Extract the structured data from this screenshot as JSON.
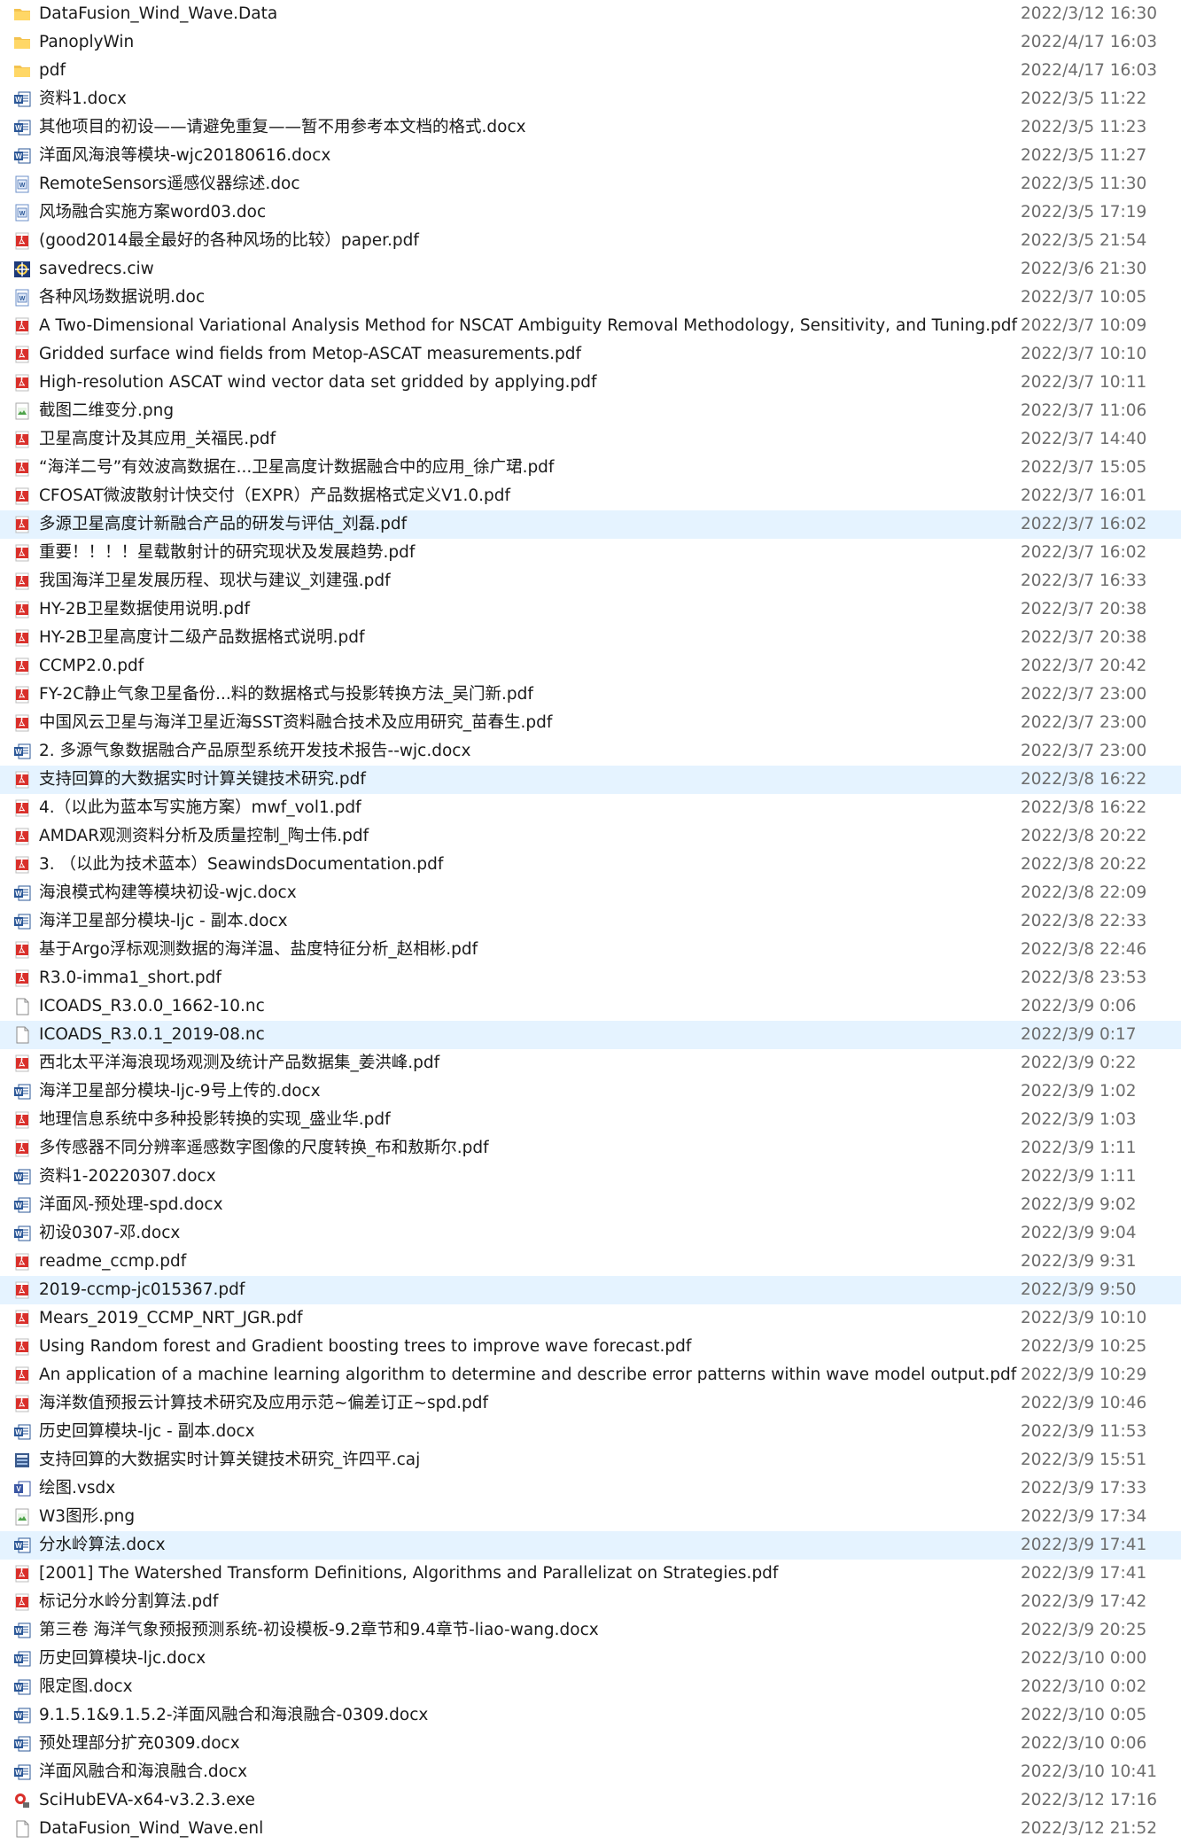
{
  "files": [
    {
      "name": "DataFusion_Wind_Wave.Data",
      "date": "2022/3/12 16:30",
      "icon": "folder-icon"
    },
    {
      "name": "PanoplyWin",
      "date": "2022/4/17 16:03",
      "icon": "folder-icon"
    },
    {
      "name": "pdf",
      "date": "2022/4/17 16:03",
      "icon": "folder-icon"
    },
    {
      "name": "资料1.docx",
      "date": "2022/3/5 11:22",
      "icon": "word-docx-icon"
    },
    {
      "name": "其他项目的初设——请避免重复——暂不用参考本文档的格式.docx",
      "date": "2022/3/5 11:23",
      "icon": "word-docx-icon"
    },
    {
      "name": "洋面风海浪等模块-wjc20180616.docx",
      "date": "2022/3/5 11:27",
      "icon": "word-docx-icon"
    },
    {
      "name": "RemoteSensors遥感仪器综述.doc",
      "date": "2022/3/5 11:30",
      "icon": "word-doc-icon"
    },
    {
      "name": "风场融合实施方案word03.doc",
      "date": "2022/3/5 17:19",
      "icon": "word-doc-icon"
    },
    {
      "name": "(good2014最全最好的各种风场的比较）paper.pdf",
      "date": "2022/3/5 21:54",
      "icon": "pdf-icon"
    },
    {
      "name": "savedrecs.ciw",
      "date": "2022/3/6 21:30",
      "icon": "ciw-icon"
    },
    {
      "name": "各种风场数据说明.doc",
      "date": "2022/3/7 10:05",
      "icon": "word-doc-icon"
    },
    {
      "name": "A Two-Dimensional Variational Analysis Method for NSCAT Ambiguity Removal Methodology, Sensitivity, and Tuning.pdf",
      "date": "2022/3/7 10:09",
      "icon": "pdf-icon"
    },
    {
      "name": "Gridded surface wind fields from Metop-ASCAT measurements.pdf",
      "date": "2022/3/7 10:10",
      "icon": "pdf-icon"
    },
    {
      "name": "High-resolution ASCAT wind vector data set gridded by applying.pdf",
      "date": "2022/3/7 10:11",
      "icon": "pdf-icon"
    },
    {
      "name": "截图二维变分.png",
      "date": "2022/3/7 11:06",
      "icon": "png-icon"
    },
    {
      "name": "卫星高度计及其应用_关福民.pdf",
      "date": "2022/3/7 14:40",
      "icon": "pdf-icon"
    },
    {
      "name": "“海洋二号”有效波高数据在...卫星高度计数据融合中的应用_徐广珺.pdf",
      "date": "2022/3/7 15:05",
      "icon": "pdf-icon"
    },
    {
      "name": "CFOSAT微波散射计快交付（EXPR）产品数据格式定义V1.0.pdf",
      "date": "2022/3/7 16:01",
      "icon": "pdf-icon"
    },
    {
      "name": "多源卫星高度计新融合产品的研发与评估_刘磊.pdf",
      "date": "2022/3/7 16:02",
      "icon": "pdf-icon",
      "selected": true
    },
    {
      "name": "重要！！！！星载散射计的研究现状及发展趋势.pdf",
      "date": "2022/3/7 16:02",
      "icon": "pdf-icon"
    },
    {
      "name": "我国海洋卫星发展历程、现状与建议_刘建强.pdf",
      "date": "2022/3/7 16:33",
      "icon": "pdf-icon"
    },
    {
      "name": "HY-2B卫星数据使用说明.pdf",
      "date": "2022/3/7 20:38",
      "icon": "pdf-icon"
    },
    {
      "name": "HY-2B卫星高度计二级产品数据格式说明.pdf",
      "date": "2022/3/7 20:38",
      "icon": "pdf-icon"
    },
    {
      "name": "CCMP2.0.pdf",
      "date": "2022/3/7 20:42",
      "icon": "pdf-icon"
    },
    {
      "name": "FY-2C静止气象卫星备份...料的数据格式与投影转换方法_吴门新.pdf",
      "date": "2022/3/7 23:00",
      "icon": "pdf-icon"
    },
    {
      "name": "中国风云卫星与海洋卫星近海SST资料融合技术及应用研究_苗春生.pdf",
      "date": "2022/3/7 23:00",
      "icon": "pdf-icon"
    },
    {
      "name": "2. 多源气象数据融合产品原型系统开发技术报告--wjc.docx",
      "date": "2022/3/7 23:00",
      "icon": "word-docx-icon"
    },
    {
      "name": "支持回算的大数据实时计算关键技术研究.pdf",
      "date": "2022/3/8 16:22",
      "icon": "pdf-icon",
      "selected": true
    },
    {
      "name": "4.（以此为蓝本写实施方案）mwf_vol1.pdf",
      "date": "2022/3/8 16:22",
      "icon": "pdf-icon"
    },
    {
      "name": "AMDAR观测资料分析及质量控制_陶士伟.pdf",
      "date": "2022/3/8 20:22",
      "icon": "pdf-icon"
    },
    {
      "name": "3. （以此为技术蓝本）SeawindsDocumentation.pdf",
      "date": "2022/3/8 20:22",
      "icon": "pdf-icon"
    },
    {
      "name": "海浪模式构建等模块初设-wjc.docx",
      "date": "2022/3/8 22:09",
      "icon": "word-docx-icon"
    },
    {
      "name": "海洋卫星部分模块-ljc - 副本.docx",
      "date": "2022/3/8 22:33",
      "icon": "word-docx-icon"
    },
    {
      "name": "基于Argo浮标观测数据的海洋温、盐度特征分析_赵相彬.pdf",
      "date": "2022/3/8 22:46",
      "icon": "pdf-icon"
    },
    {
      "name": "R3.0-imma1_short.pdf",
      "date": "2022/3/8 23:53",
      "icon": "pdf-icon"
    },
    {
      "name": "ICOADS_R3.0.0_1662-10.nc",
      "date": "2022/3/9 0:06",
      "icon": "blank-file-icon"
    },
    {
      "name": "ICOADS_R3.0.1_2019-08.nc",
      "date": "2022/3/9 0:17",
      "icon": "blank-file-icon",
      "selected": true
    },
    {
      "name": "西北太平洋海浪现场观测及统计产品数据集_姜洪峰.pdf",
      "date": "2022/3/9 0:22",
      "icon": "pdf-icon"
    },
    {
      "name": "海洋卫星部分模块-ljc-9号上传的.docx",
      "date": "2022/3/9 1:02",
      "icon": "word-docx-icon"
    },
    {
      "name": "地理信息系统中多种投影转换的实现_盛业华.pdf",
      "date": "2022/3/9 1:03",
      "icon": "pdf-icon"
    },
    {
      "name": "多传感器不同分辨率遥感数字图像的尺度转换_布和敖斯尔.pdf",
      "date": "2022/3/9 1:11",
      "icon": "pdf-icon"
    },
    {
      "name": "资料1-20220307.docx",
      "date": "2022/3/9 1:11",
      "icon": "word-docx-icon"
    },
    {
      "name": "洋面风-预处理-spd.docx",
      "date": "2022/3/9 9:02",
      "icon": "word-docx-icon"
    },
    {
      "name": "初设0307-邓.docx",
      "date": "2022/3/9 9:04",
      "icon": "word-docx-icon"
    },
    {
      "name": "readme_ccmp.pdf",
      "date": "2022/3/9 9:31",
      "icon": "pdf-icon"
    },
    {
      "name": "2019-ccmp-jc015367.pdf",
      "date": "2022/3/9 9:50",
      "icon": "pdf-icon",
      "selected": true
    },
    {
      "name": "Mears_2019_CCMP_NRT_JGR.pdf",
      "date": "2022/3/9 10:10",
      "icon": "pdf-icon"
    },
    {
      "name": "Using Random forest and Gradient boosting trees to improve wave forecast.pdf",
      "date": "2022/3/9 10:25",
      "icon": "pdf-icon"
    },
    {
      "name": "An application of a machine learning algorithm to determine and describe error patterns within wave model output.pdf",
      "date": "2022/3/9 10:29",
      "icon": "pdf-icon"
    },
    {
      "name": "海洋数值预报云计算技术研究及应用示范~偏差订正~spd.pdf",
      "date": "2022/3/9 10:46",
      "icon": "pdf-icon"
    },
    {
      "name": "历史回算模块-ljc - 副本.docx",
      "date": "2022/3/9 11:53",
      "icon": "word-docx-icon"
    },
    {
      "name": "支持回算的大数据实时计算关键技术研究_许四平.caj",
      "date": "2022/3/9 15:51",
      "icon": "caj-icon"
    },
    {
      "name": "绘图.vsdx",
      "date": "2022/3/9 17:33",
      "icon": "visio-icon"
    },
    {
      "name": "W3图形.png",
      "date": "2022/3/9 17:34",
      "icon": "png-icon"
    },
    {
      "name": "分水岭算法.docx",
      "date": "2022/3/9 17:41",
      "icon": "word-docx-icon",
      "selected": true
    },
    {
      "name": "[2001] The Watershed Transform Definitions, Algorithms and Parallelizat on Strategies.pdf",
      "date": "2022/3/9 17:41",
      "icon": "pdf-icon"
    },
    {
      "name": "标记分水岭分割算法.pdf",
      "date": "2022/3/9 17:42",
      "icon": "pdf-icon"
    },
    {
      "name": "第三卷 海洋气象预报预测系统-初设模板-9.2章节和9.4章节-liao-wang.docx",
      "date": "2022/3/9 20:25",
      "icon": "word-docx-icon"
    },
    {
      "name": "历史回算模块-ljc.docx",
      "date": "2022/3/10 0:00",
      "icon": "word-docx-icon"
    },
    {
      "name": "限定图.docx",
      "date": "2022/3/10 0:02",
      "icon": "word-docx-icon"
    },
    {
      "name": "9.1.5.1&9.1.5.2-洋面风融合和海浪融合-0309.docx",
      "date": "2022/3/10 0:05",
      "icon": "word-docx-icon"
    },
    {
      "name": "预处理部分扩充0309.docx",
      "date": "2022/3/10 0:06",
      "icon": "word-docx-icon"
    },
    {
      "name": "洋面风融合和海浪融合.docx",
      "date": "2022/3/10 10:41",
      "icon": "word-docx-icon"
    },
    {
      "name": "SciHubEVA-x64-v3.2.3.exe",
      "date": "2022/3/12 17:16",
      "icon": "exe-icon"
    },
    {
      "name": "DataFusion_Wind_Wave.enl",
      "date": "2022/3/12 21:52",
      "icon": "blank-file-icon"
    }
  ]
}
